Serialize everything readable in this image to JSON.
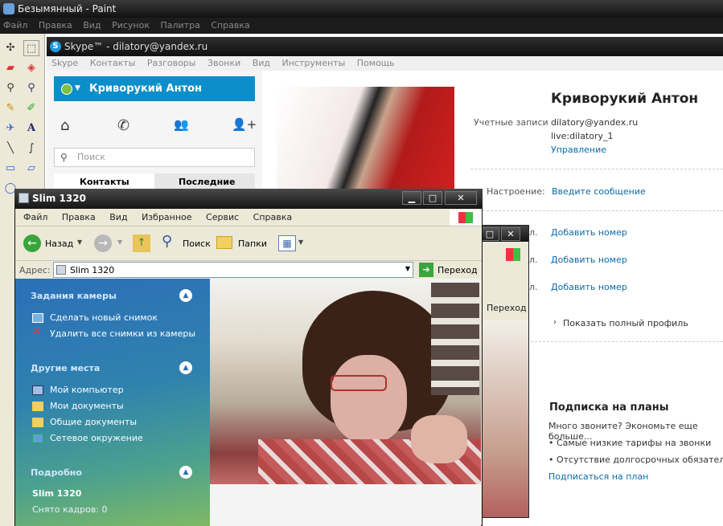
{
  "paint": {
    "title": "Безымянный - Paint",
    "menu": [
      "Файл",
      "Правка",
      "Вид",
      "Рисунок",
      "Палитра",
      "Справка"
    ]
  },
  "skype": {
    "title": "Skype™ - dilatory@yandex.ru",
    "menu": [
      "Skype",
      "Контакты",
      "Разговоры",
      "Звонки",
      "Вид",
      "Инструменты",
      "Помощь"
    ],
    "profile_name_bar": "Криворукий Антон",
    "search_placeholder": "Поиск",
    "tab_contacts": "Контакты",
    "tab_recent": "Последние",
    "profile": {
      "name": "Криворукий Антон",
      "accounts_label": "Учетные записи",
      "account1": "dilatory@yandex.ru",
      "account2": "live:dilatory_1",
      "manage_link": "Управление",
      "mood_label": "Настроение:",
      "mood_link": "Введите сообщение",
      "phone_label": "л.",
      "add_number": "Добавить номер",
      "show_full_profile": "Показать полный профиль"
    },
    "plans": {
      "title": "Подписка на планы",
      "line1": "Много звоните? Экономьте еще больше...",
      "bullet1": "• Самые низкие тарифы на звонки",
      "bullet2": "• Отсутствие долгосрочных обязательств",
      "link": "Подписаться на план"
    }
  },
  "background_window": {
    "go_label": "Переход"
  },
  "explorer": {
    "title": "Slim 1320",
    "menu": [
      "Файл",
      "Правка",
      "Вид",
      "Избранное",
      "Сервис",
      "Справка"
    ],
    "toolbar": {
      "back": "Назад",
      "search": "Поиск",
      "folders": "Папки"
    },
    "address_label": "Адрес:",
    "address_value": "Slim 1320",
    "go_label": "Переход",
    "camera_tasks": {
      "title": "Задания камеры",
      "items": [
        "Сделать новый снимок",
        "Удалить все снимки из камеры"
      ]
    },
    "other_places": {
      "title": "Другие места",
      "items": [
        "Мой компьютер",
        "Мои документы",
        "Общие документы",
        "Сетевое окружение"
      ]
    },
    "details": {
      "title": "Подробно",
      "name": "Slim 1320",
      "frames": "Снято кадров: 0"
    }
  }
}
